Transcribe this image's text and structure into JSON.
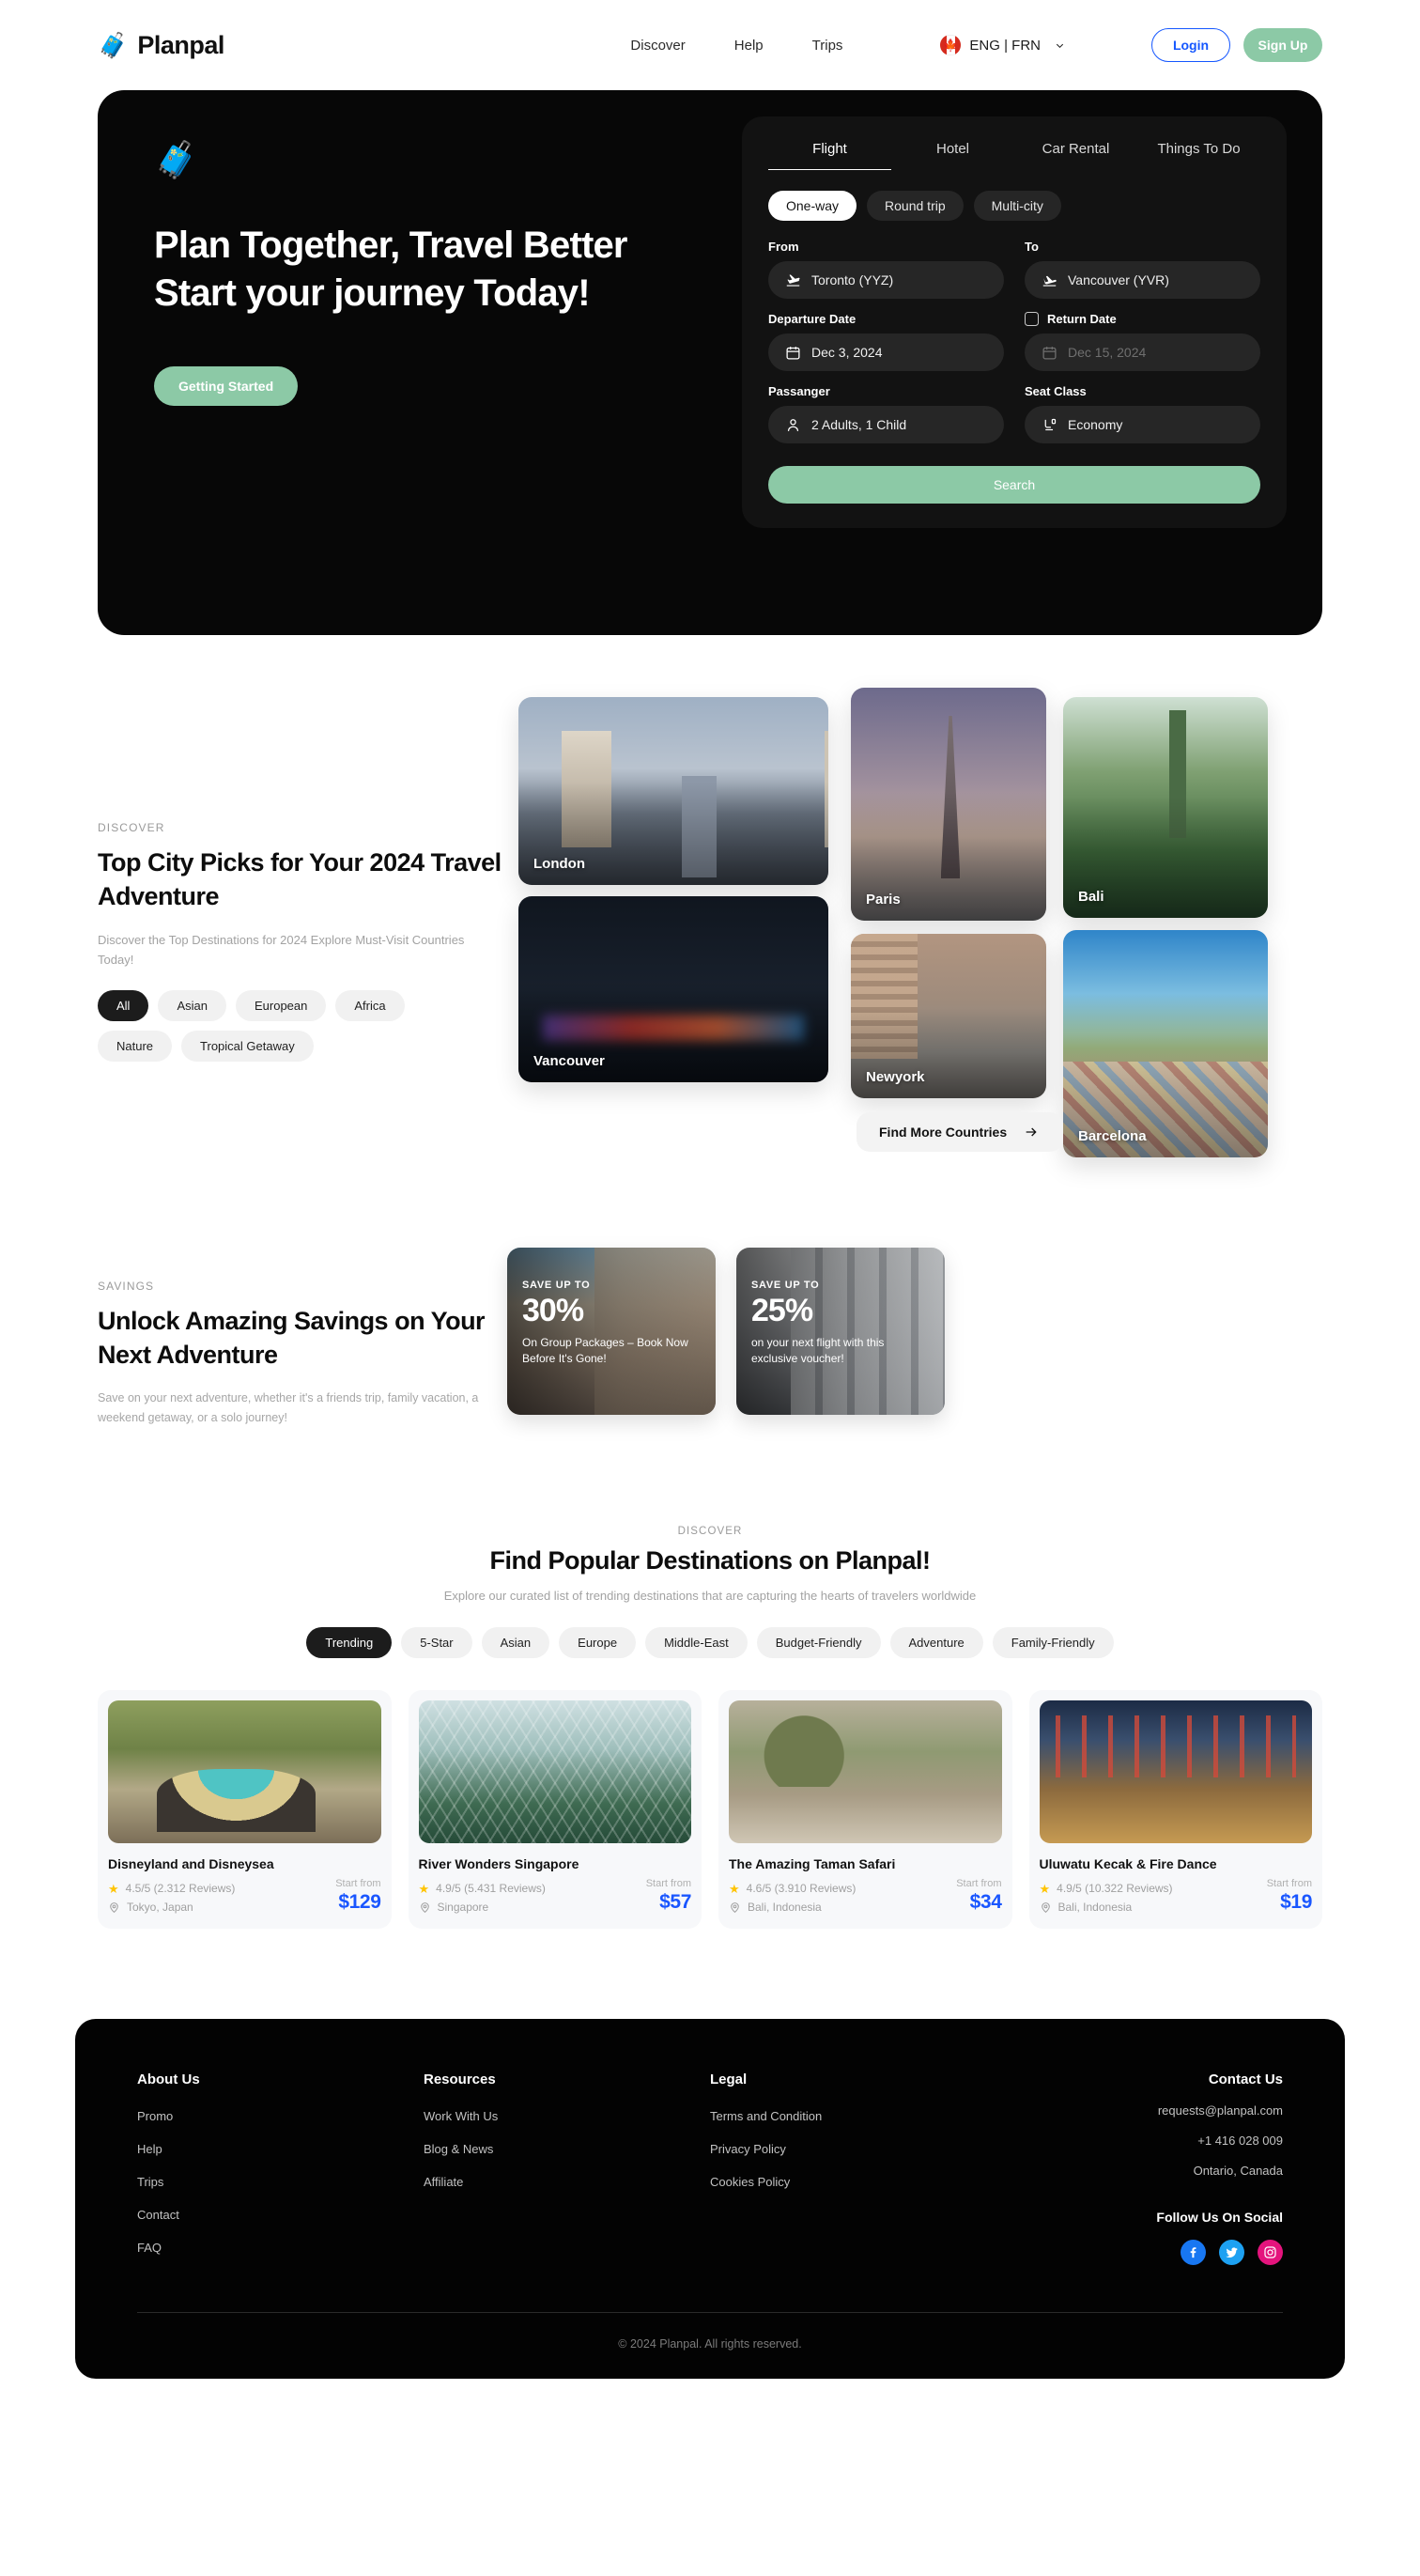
{
  "header": {
    "brand": "Planpal",
    "brand_icon": "people-with-luggage-icon",
    "nav": [
      {
        "label": "Discover"
      },
      {
        "label": "Help"
      },
      {
        "label": "Trips"
      }
    ],
    "language": {
      "value": "ENG | FRN",
      "flag": "canada-flag-icon",
      "chevron": "chevron-down-icon"
    },
    "login_label": "Login",
    "signup_label": "Sign Up"
  },
  "hero": {
    "emoji": "people-with-luggage-icon",
    "title_line1": "Plan Together, Travel Better",
    "title_line2": "Start your journey Today!",
    "cta_label": "Getting Started",
    "search": {
      "tabs": [
        {
          "label": "Flight",
          "active": true
        },
        {
          "label": "Hotel",
          "active": false
        },
        {
          "label": "Car Rental",
          "active": false
        },
        {
          "label": "Things To Do",
          "active": false
        }
      ],
      "trip_types": [
        {
          "label": "One-way",
          "active": true
        },
        {
          "label": "Round trip",
          "active": false
        },
        {
          "label": "Multi-city",
          "active": false
        }
      ],
      "from_label": "From",
      "from_value": "Toronto (YYZ)",
      "to_label": "To",
      "to_value": "Vancouver (YVR)",
      "departure_label": "Departure Date",
      "departure_value": "Dec 3, 2024",
      "return_label": "Return Date",
      "return_value": "Dec 15, 2024",
      "passenger_label": "Passanger",
      "passenger_value": "2 Adults, 1 Child",
      "seat_label": "Seat Class",
      "seat_value": "Economy",
      "search_label": "Search"
    }
  },
  "cities": {
    "eyebrow": "DISCOVER",
    "title": "Top City Picks for Your 2024 Travel Adventure",
    "subtitle": "Discover the Top Destinations for 2024 Explore Must-Visit Countries Today!",
    "filters": [
      {
        "label": "All",
        "active": true
      },
      {
        "label": "Asian",
        "active": false
      },
      {
        "label": "European",
        "active": false
      },
      {
        "label": "Africa",
        "active": false
      },
      {
        "label": "Nature",
        "active": false
      },
      {
        "label": "Tropical Getaway",
        "active": false
      }
    ],
    "cards": [
      {
        "name": "London"
      },
      {
        "name": "Vancouver"
      },
      {
        "name": "Paris"
      },
      {
        "name": "Newyork"
      },
      {
        "name": "Bali"
      },
      {
        "name": "Barcelona"
      }
    ],
    "more_label": "Find More Countries"
  },
  "savings": {
    "eyebrow": "SAVINGS",
    "title": "Unlock Amazing Savings on Your Next Adventure",
    "subtitle": "Save on your next adventure, whether it's a friends trip, family vacation, a weekend getaway, or a solo journey!",
    "promos": [
      {
        "up": "SAVE UP TO",
        "percent": "30%",
        "note": "On Group Packages – Book Now Before It's Gone!"
      },
      {
        "up": "SAVE UP TO",
        "percent": "25%",
        "note": "on your next flight with this exclusive voucher!"
      }
    ]
  },
  "popular": {
    "eyebrow": "DISCOVER",
    "title": "Find Popular Destinations on Planpal!",
    "subtitle": "Explore our curated list of trending destinations that are capturing the hearts of travelers worldwide",
    "filters": [
      {
        "label": "Trending",
        "active": true
      },
      {
        "label": "5-Star",
        "active": false
      },
      {
        "label": "Asian",
        "active": false
      },
      {
        "label": "Europe",
        "active": false
      },
      {
        "label": "Middle-East",
        "active": false
      },
      {
        "label": "Budget-Friendly",
        "active": false
      },
      {
        "label": "Adventure",
        "active": false
      },
      {
        "label": "Family-Friendly",
        "active": false
      }
    ],
    "start_from_label": "Start from",
    "cards": [
      {
        "name": "Disneyland and Disneysea",
        "rating": "4.5/5 (2.312 Reviews)",
        "location": "Tokyo, Japan",
        "price": "$129"
      },
      {
        "name": "River Wonders Singapore",
        "rating": "4.9/5 (5.431 Reviews)",
        "location": "Singapore",
        "price": "$57"
      },
      {
        "name": "The Amazing Taman Safari",
        "rating": "4.6/5 (3.910 Reviews)",
        "location": "Bali, Indonesia",
        "price": "$34"
      },
      {
        "name": "Uluwatu Kecak & Fire Dance",
        "rating": "4.9/5 (10.322 Reviews)",
        "location": "Bali, Indonesia",
        "price": "$19"
      }
    ]
  },
  "footer": {
    "columns": [
      {
        "title": "About Us",
        "links": [
          {
            "label": "Promo"
          },
          {
            "label": "Help"
          },
          {
            "label": "Trips"
          },
          {
            "label": "Contact"
          },
          {
            "label": "FAQ"
          }
        ]
      },
      {
        "title": "Resources",
        "links": [
          {
            "label": "Work With Us"
          },
          {
            "label": "Blog & News"
          },
          {
            "label": "Affiliate"
          }
        ]
      },
      {
        "title": "Legal",
        "links": [
          {
            "label": "Terms and Condition"
          },
          {
            "label": "Privacy Policy"
          },
          {
            "label": "Cookies Policy"
          }
        ]
      }
    ],
    "contact": {
      "title": "Contact Us",
      "email": "requests@planpal.com",
      "phone": "+1 416 028 009",
      "address": "Ontario, Canada",
      "follow_label": "Follow Us On Social",
      "socials": [
        {
          "name": "facebook-icon"
        },
        {
          "name": "twitter-icon"
        },
        {
          "name": "instagram-icon"
        }
      ]
    },
    "copyright": "© 2024 Planpal. All rights reserved."
  },
  "colors": {
    "accent_green": "#8cc9a6",
    "price_blue": "#1a56ff",
    "login_blue": "#1557ff",
    "dark": "#070707",
    "star_yellow": "#ffc403"
  }
}
